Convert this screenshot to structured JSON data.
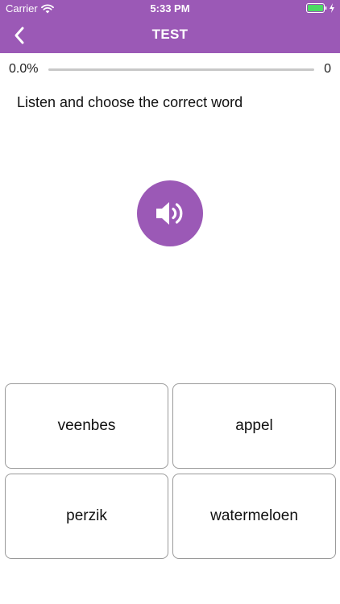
{
  "status_bar": {
    "carrier": "Carrier",
    "time": "5:33 PM",
    "icons": [
      "wifi-icon",
      "battery-icon",
      "charging-bolt-icon"
    ]
  },
  "nav": {
    "title": "TEST",
    "back_icon": "chevron-left-icon"
  },
  "progress": {
    "percent_text": "0.0%",
    "count": "0",
    "fraction": 0.0
  },
  "instruction": "Listen and choose the correct word",
  "speaker_icon": "speaker-icon",
  "answers": [
    {
      "label": "veenbes"
    },
    {
      "label": "appel"
    },
    {
      "label": "perzik"
    },
    {
      "label": "watermeloen"
    }
  ],
  "colors": {
    "accent": "#9b59b6",
    "battery": "#4cd964",
    "border": "#9a9a9a"
  }
}
